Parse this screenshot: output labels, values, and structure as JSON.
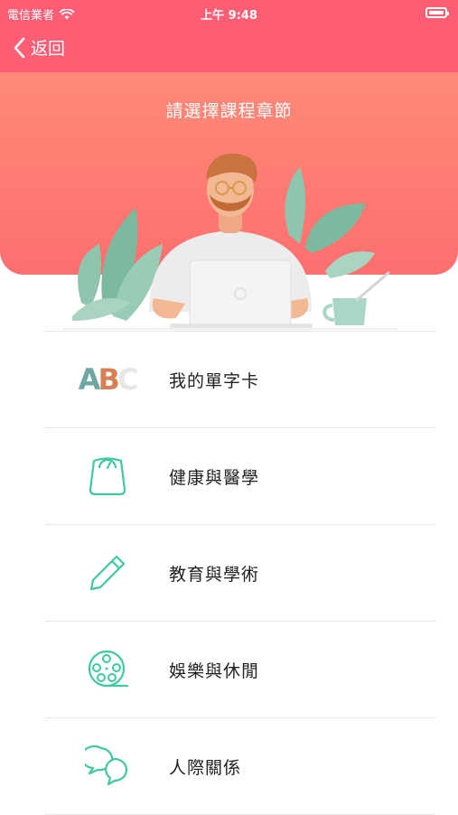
{
  "status_bar": {
    "carrier": "電信業者",
    "time": "上午 9:48"
  },
  "nav": {
    "back_label": "返回"
  },
  "hero": {
    "title": "請選擇課程章節"
  },
  "icon_text": {
    "a": "A",
    "b": "B",
    "c": "C"
  },
  "menu": [
    {
      "label": "我的單字卡",
      "icon": "abc-icon"
    },
    {
      "label": "健康與醫學",
      "icon": "scale-icon"
    },
    {
      "label": "教育與學術",
      "icon": "pencil-icon"
    },
    {
      "label": "娛樂與休閒",
      "icon": "film-reel-icon"
    },
    {
      "label": "人際關係",
      "icon": "chat-bubbles-icon"
    }
  ],
  "colors": {
    "header": "#ff5d74",
    "hero": "#fd7a72",
    "icon_teal": "#3ec9a2"
  }
}
